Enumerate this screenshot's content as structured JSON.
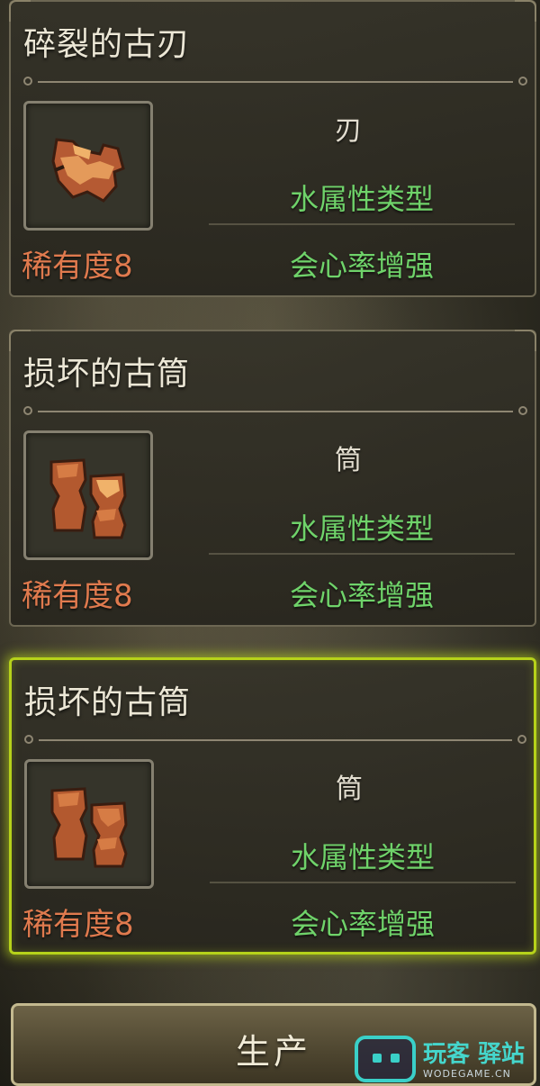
{
  "cards": [
    {
      "title": "碎裂的古刃",
      "icon": "broken-blade-icon",
      "rarity": "稀有度8",
      "type": "刃",
      "attr1": "水属性类型",
      "attr2": "会心率增强",
      "selected": false
    },
    {
      "title": "损坏的古筒",
      "icon": "broken-cylinder-icon",
      "rarity": "稀有度8",
      "type": "筒",
      "attr1": "水属性类型",
      "attr2": "会心率增强",
      "selected": false
    },
    {
      "title": "损坏的古筒",
      "icon": "broken-cylinder-icon",
      "rarity": "稀有度8",
      "type": "筒",
      "attr1": "水属性类型",
      "attr2": "会心率增强",
      "selected": true
    }
  ],
  "produce_button": {
    "label": "生产"
  },
  "watermark": {
    "name": "玩客 驿站",
    "url": "WODEGAME.CN"
  },
  "colors": {
    "rarity": "#e07a4e",
    "attribute": "#6fd36a",
    "selected_border": "#b6d21a"
  }
}
